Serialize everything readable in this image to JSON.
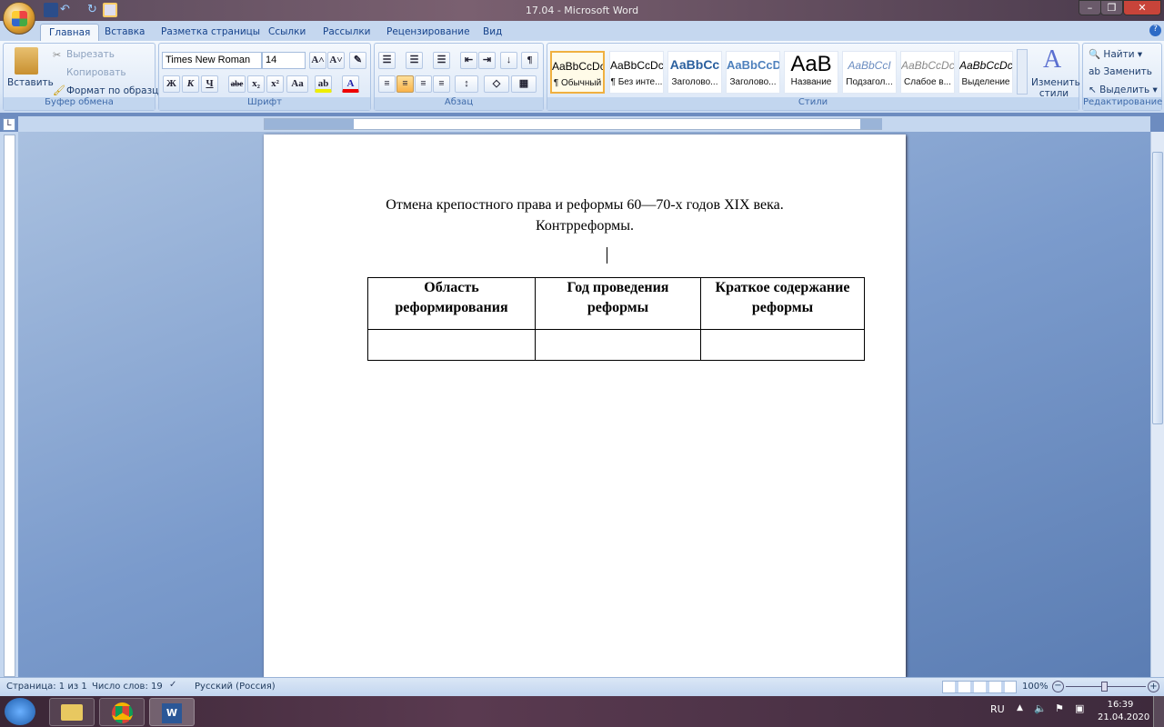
{
  "window": {
    "title": "17.04 - Microsoft Word",
    "minimize": "–",
    "maximize": "❐",
    "close": "✕"
  },
  "tabs": [
    "Главная",
    "Вставка",
    "Разметка страницы",
    "Ссылки",
    "Рассылки",
    "Рецензирование",
    "Вид"
  ],
  "clipboard": {
    "paste": "Вставить",
    "cut": "Вырезать",
    "copy": "Копировать",
    "format_painter": "Формат по образцу",
    "label": "Буфер обмена"
  },
  "font": {
    "name": "Times New Roman",
    "size": "14",
    "label": "Шрифт",
    "bold": "Ж",
    "italic": "К",
    "underline": "Ч",
    "strike": "abe",
    "sub": "x₂",
    "sup": "x²",
    "case": "Aa",
    "grow": "A˄",
    "shrink": "A˅",
    "color_letter": "A",
    "highlight": "ab"
  },
  "paragraph": {
    "label": "Абзац",
    "pilcrow": "¶"
  },
  "styles": {
    "label": "Стили",
    "items": [
      {
        "preview": "AaBbCcDc",
        "name": "¶ Обычный"
      },
      {
        "preview": "AaBbCcDc",
        "name": "¶ Без инте..."
      },
      {
        "preview": "AaBbCc",
        "name": "Заголово..."
      },
      {
        "preview": "AaBbCcD",
        "name": "Заголово..."
      },
      {
        "preview": "AaB",
        "name": "Название"
      },
      {
        "preview": "AaBbCcI",
        "name": "Подзагол..."
      },
      {
        "preview": "AaBbCcDc",
        "name": "Слабое в..."
      },
      {
        "preview": "AaBbCcDc",
        "name": "Выделение"
      }
    ],
    "change": "Изменить стили"
  },
  "editing": {
    "label": "Редактирование",
    "find": "Найти",
    "replace": "Заменить",
    "select": "Выделить"
  },
  "document": {
    "title_line1": "Отмена крепостного права и реформы 60—70-х годов XIX века.",
    "title_line2": "Контрреформы.",
    "table": {
      "headers": [
        "Область реформирования",
        "Год проведения реформы",
        "Краткое содержание реформы"
      ],
      "rows": [
        [
          "",
          "",
          ""
        ]
      ]
    }
  },
  "status": {
    "page": "Страница: 1 из 1",
    "words": "Число слов: 19",
    "language": "Русский (Россия)",
    "zoom": "100%"
  },
  "taskbar": {
    "lang": "RU",
    "time": "16:39",
    "date": "21.04.2020"
  }
}
